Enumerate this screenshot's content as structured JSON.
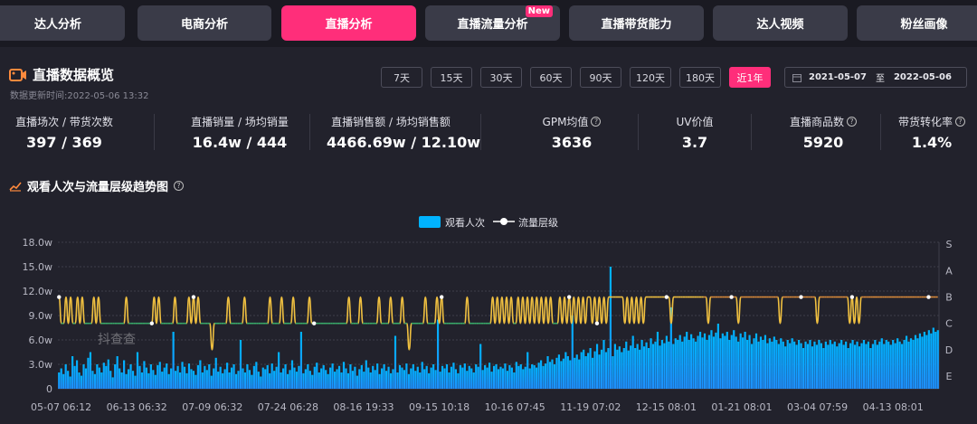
{
  "tabs": [
    {
      "label": "达人分析",
      "active": false
    },
    {
      "label": "电商分析",
      "active": false
    },
    {
      "label": "直播分析",
      "active": true
    },
    {
      "label": "直播流量分析",
      "active": false,
      "badge": "New"
    },
    {
      "label": "直播带货能力",
      "active": false
    },
    {
      "label": "达人视频",
      "active": false
    },
    {
      "label": "粉丝画像",
      "active": false
    }
  ],
  "overview": {
    "title": "直播数据概览",
    "update_time": "数据更新时间:2022-05-06 13:32",
    "periods": [
      "7天",
      "15天",
      "30天",
      "60天",
      "90天",
      "120天",
      "180天",
      "近1年"
    ],
    "active_period": "近1年",
    "date_start": "2021-05-07",
    "date_sep": "至",
    "date_end": "2022-05-06"
  },
  "stats": [
    {
      "label": "直播场次 / 带货次数",
      "value": "397 / 369",
      "help": false
    },
    {
      "label": "直播销量 / 场均销量",
      "value": "16.4w / 444",
      "help": false
    },
    {
      "label": "直播销售额 / 场均销售额",
      "value": "4466.69w / 12.10w",
      "help": false
    },
    {
      "label": "GPM均值",
      "value": "3636",
      "help": true
    },
    {
      "label": "UV价值",
      "value": "3.7",
      "help": false
    },
    {
      "label": "直播商品数",
      "value": "5920",
      "help": true
    },
    {
      "label": "带货转化率",
      "value": "1.4%",
      "help": true
    }
  ],
  "chart_title": "观看人次与流量层级趋势图",
  "chart_data": {
    "type": "bar+line",
    "legend": [
      "观看人次",
      "流量层级"
    ],
    "legend_placement": "top-center",
    "y_left_ticks": [
      "0",
      "3.0w",
      "6.0w",
      "9.0w",
      "12.0w",
      "15.0w",
      "18.0w"
    ],
    "y_left_range": [
      0,
      180000
    ],
    "y_right_levels": [
      "E",
      "D",
      "C",
      "B",
      "A",
      "S"
    ],
    "x_ticks": [
      "05-07 06:12",
      "06-13 06:32",
      "07-09 06:32",
      "07-24 06:28",
      "08-16 19:33",
      "09-15 10:18",
      "10-16 07:45",
      "11-19 07:02",
      "12-15 08:01",
      "01-21 08:01",
      "03-04 07:59",
      "04-13 08:01"
    ],
    "grid": true,
    "watermark": "抖查查",
    "colors": {
      "bar": "#1e90ff",
      "bar_top": "#00b3ff",
      "line_b": "#f0c040",
      "line_c": "#3aaa6a",
      "line_late": "#d88a3a",
      "point": "#ffffff"
    },
    "series": [
      {
        "name": "观看人次",
        "values": [
          20000,
          25000,
          18000,
          30000,
          22000,
          15000,
          40000,
          28000,
          35000,
          20000,
          16000,
          30000,
          25000,
          38000,
          45000,
          22000,
          18000,
          30000,
          26000,
          20000,
          32000,
          28000,
          36000,
          22000,
          14000,
          30000,
          40000,
          25000,
          20000,
          35000,
          18000,
          24000,
          30000,
          22000,
          16000,
          45000,
          28000,
          20000,
          34000,
          26000,
          19000,
          30000,
          23000,
          17000,
          29000,
          33000,
          21000,
          26000,
          31000,
          18000,
          25000,
          70000,
          22000,
          28000,
          20000,
          33000,
          27000,
          19000,
          31000,
          24000,
          22000,
          17000,
          29000,
          35000,
          20000,
          28000,
          23000,
          30000,
          16000,
          25000,
          38000,
          21000,
          27000,
          19000,
          24000,
          32000,
          20000,
          26000,
          30000,
          18000,
          22000,
          60000,
          25000,
          20000,
          30000,
          23000,
          17000,
          28000,
          33000,
          21000,
          15000,
          26000,
          24000,
          29000,
          19000,
          31000,
          22000,
          27000,
          45000,
          20000,
          25000,
          30000,
          18000,
          23000,
          35000,
          26000,
          21000,
          28000,
          70000,
          19000,
          24000,
          30000,
          22000,
          17000,
          27000,
          32000,
          20000,
          25000,
          29000,
          23000,
          18000,
          26000,
          31000,
          21000,
          24000,
          28000,
          20000,
          33000,
          25000,
          19000,
          30000,
          22000,
          27000,
          16000,
          24000,
          29000,
          21000,
          35000,
          26000,
          20000,
          28000,
          23000,
          31000,
          18000,
          25000,
          30000,
          22000,
          27000,
          19000,
          24000,
          65000,
          20000,
          29000,
          26000,
          23000,
          31000,
          18000,
          25000,
          30000,
          22000,
          27000,
          20000,
          33000,
          24000,
          28000,
          19000,
          26000,
          30000,
          23000,
          85000,
          21000,
          28000,
          25000,
          30000,
          20000,
          27000,
          32000,
          24000,
          19000,
          29000,
          26000,
          31000,
          22000,
          28000,
          25000,
          20000,
          30000,
          27000,
          55000,
          23000,
          29000,
          26000,
          32000,
          21000,
          28000,
          30000,
          24000,
          27000,
          25000,
          31000,
          22000,
          29000,
          26000,
          20000,
          33000,
          28000,
          30000,
          24000,
          27000,
          45000,
          25000,
          30000,
          29000,
          26000,
          32000,
          35000,
          28000,
          31000,
          40000,
          33000,
          36000,
          30000,
          38000,
          42000,
          34000,
          37000,
          45000,
          40000,
          35000,
          90000,
          38000,
          42000,
          36000,
          45000,
          48000,
          40000,
          44000,
          50000,
          38000,
          46000,
          55000,
          42000,
          48000,
          60000,
          45000,
          50000,
          150000,
          40000,
          55000,
          48000,
          52000,
          45000,
          50000,
          58000,
          47000,
          53000,
          65000,
          50000,
          55000,
          48000,
          60000,
          52000,
          57000,
          50000,
          62000,
          55000,
          58000,
          70000,
          53000,
          60000,
          56000,
          65000,
          58000,
          100000,
          55000,
          62000,
          60000,
          66000,
          58000,
          64000,
          70000,
          60000,
          67000,
          62000,
          58000,
          65000,
          70000,
          63000,
          68000,
          60000,
          66000,
          72000,
          64000,
          69000,
          80000,
          62000,
          68000,
          65000,
          70000,
          60000,
          66000,
          72000,
          64000,
          58000,
          68000,
          63000,
          70000,
          60000,
          66000,
          55000,
          62000,
          68000,
          58000,
          64000,
          60000,
          66000,
          56000,
          62000,
          58000,
          64000,
          60000,
          55000,
          62000,
          58000,
          52000,
          60000,
          56000,
          62000,
          58000,
          54000,
          60000,
          56000,
          50000,
          58000,
          55000,
          60000,
          52000,
          58000,
          54000,
          60000,
          56000,
          50000,
          58000,
          54000,
          60000,
          55000,
          58000,
          52000,
          56000,
          60000,
          54000,
          58000,
          50000,
          56000,
          60000,
          54000,
          58000,
          52000,
          56000,
          60000,
          55000,
          58000,
          50000,
          55000,
          60000,
          54000,
          58000,
          62000,
          55000,
          60000,
          58000,
          54000,
          60000,
          56000,
          62000,
          58000,
          55000,
          60000,
          65000,
          58000,
          62000,
          60000,
          66000,
          62000,
          68000,
          64000,
          70000,
          66000,
          72000,
          68000,
          75000,
          70000,
          72000
        ]
      },
      {
        "name": "流量层级",
        "values": [
          "B",
          "C",
          "C",
          "B",
          "C",
          "B",
          "C",
          "C",
          "B",
          "C",
          "B",
          "C",
          "C",
          "C",
          "C",
          "B",
          "C",
          "B",
          "C",
          "C",
          "C",
          "C",
          "C",
          "C",
          "C",
          "C",
          "C",
          "C",
          "C",
          "B",
          "C",
          "C",
          "C",
          "C",
          "C",
          "C",
          "C",
          "C",
          "C",
          "C",
          "C",
          "B",
          "C",
          "B",
          "C",
          "C",
          "C",
          "C",
          "C",
          "C",
          "B",
          "C",
          "C",
          "C",
          "C",
          "C",
          "B",
          "C",
          "B",
          "C",
          "B",
          "C",
          "C",
          "C",
          "C",
          "C",
          "D",
          "C",
          "C",
          "C",
          "C",
          "C",
          "C",
          "B",
          "C",
          "C",
          "C",
          "C",
          "C",
          "C",
          "B",
          "C",
          "C",
          "C",
          "C",
          "C",
          "C",
          "C",
          "C",
          "C",
          "C",
          "B",
          "C",
          "C",
          "C",
          "C",
          "B",
          "C",
          "C",
          "C",
          "C",
          "B",
          "C",
          "C",
          "C",
          "C",
          "C",
          "C",
          "B",
          "C",
          "C",
          "C",
          "C",
          "C",
          "C",
          "C",
          "C",
          "C",
          "C",
          "C",
          "C",
          "C",
          "C",
          "C",
          "C",
          "B",
          "C",
          "C",
          "C",
          "C",
          "B",
          "C",
          "C",
          "C",
          "C",
          "C",
          "C",
          "C",
          "B",
          "C",
          "C",
          "C",
          "C",
          "B",
          "C",
          "C",
          "C",
          "C",
          "B",
          "C",
          "C",
          "D",
          "C",
          "C",
          "C",
          "C",
          "C",
          "C",
          "B",
          "C",
          "C",
          "C",
          "C",
          "B",
          "C",
          "B",
          "C",
          "C",
          "C",
          "C",
          "C",
          "C",
          "C",
          "C",
          "C",
          "C",
          "B",
          "C",
          "C",
          "C",
          "C",
          "C",
          "C",
          "C",
          "C",
          "C",
          "C",
          "B",
          "C",
          "B",
          "C",
          "B",
          "C",
          "B",
          "C",
          "B",
          "C",
          "C",
          "B",
          "C",
          "B",
          "C",
          "B",
          "C",
          "B",
          "C",
          "B",
          "C",
          "B",
          "C",
          "B",
          "C",
          "B",
          "C",
          "C",
          "C",
          "B",
          "C",
          "B",
          "C",
          "B",
          "C",
          "B",
          "C",
          "B",
          "C",
          "B",
          "C",
          "B",
          "B",
          "C",
          "B",
          "C",
          "B",
          "C",
          "B",
          "C",
          "B",
          "B",
          "B",
          "B",
          "B",
          "B",
          "B",
          "C",
          "B",
          "C",
          "B",
          "C",
          "B",
          "C",
          "B",
          "C",
          "B",
          "B",
          "B",
          "B",
          "B",
          "B",
          "B",
          "B",
          "B",
          "B",
          "B",
          "C",
          "B",
          "B",
          "B",
          "B",
          "B",
          "B",
          "B",
          "B",
          "B",
          "B",
          "B",
          "B",
          "B",
          "B",
          "B",
          "C",
          "B",
          "B",
          "B",
          "B",
          "B",
          "B",
          "B",
          "B",
          "B",
          "B",
          "B",
          "B",
          "C",
          "B",
          "B",
          "B",
          "B",
          "B",
          "B",
          "B",
          "B",
          "B",
          "B",
          "B",
          "B",
          "B",
          "B",
          "B",
          "B",
          "B",
          "C",
          "B",
          "B",
          "B",
          "B",
          "B",
          "B",
          "B",
          "B",
          "B",
          "B",
          "B",
          "B",
          "B",
          "B",
          "B",
          "C",
          "B",
          "B",
          "B",
          "B",
          "B",
          "B",
          "B",
          "B",
          "B",
          "B",
          "B",
          "B",
          "B",
          "C",
          "B",
          "C",
          "B",
          "C",
          "B",
          "B",
          "B",
          "B",
          "B",
          "B",
          "B",
          "B",
          "B",
          "B",
          "B",
          "B",
          "B",
          "B",
          "B",
          "B",
          "B",
          "B",
          "B",
          "B",
          "B",
          "B",
          "B",
          "B",
          "B",
          "B",
          "B",
          "B",
          "B",
          "B",
          "B",
          "B",
          "B",
          "B"
        ]
      }
    ]
  }
}
